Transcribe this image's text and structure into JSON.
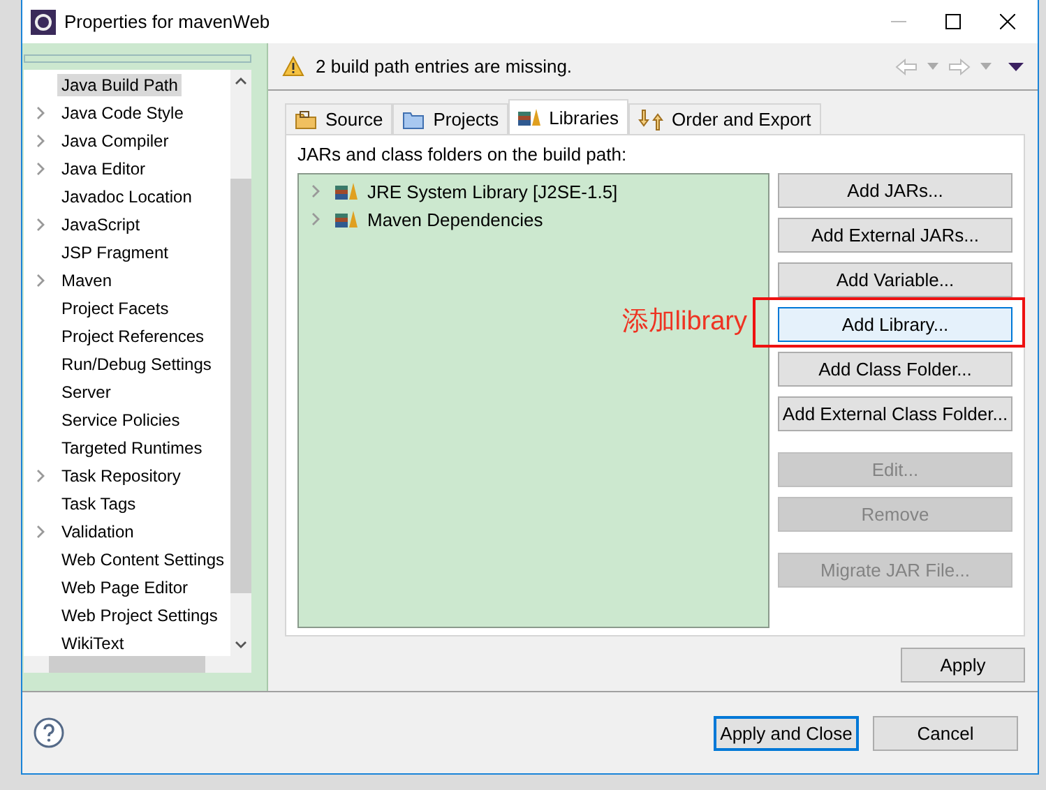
{
  "window": {
    "title": "Properties for mavenWeb"
  },
  "sidebar": {
    "items": [
      {
        "label": "Java Build Path",
        "kind": "leaf",
        "selected": true
      },
      {
        "label": "Java Code Style",
        "kind": "group",
        "selected": false
      },
      {
        "label": "Java Compiler",
        "kind": "group",
        "selected": false
      },
      {
        "label": "Java Editor",
        "kind": "group",
        "selected": false
      },
      {
        "label": "Javadoc Location",
        "kind": "leaf",
        "selected": false
      },
      {
        "label": "JavaScript",
        "kind": "group",
        "selected": false
      },
      {
        "label": "JSP Fragment",
        "kind": "leaf",
        "selected": false
      },
      {
        "label": "Maven",
        "kind": "group",
        "selected": false
      },
      {
        "label": "Project Facets",
        "kind": "leaf",
        "selected": false
      },
      {
        "label": "Project References",
        "kind": "leaf",
        "selected": false
      },
      {
        "label": "Run/Debug Settings",
        "kind": "leaf",
        "selected": false
      },
      {
        "label": "Server",
        "kind": "leaf",
        "selected": false
      },
      {
        "label": "Service Policies",
        "kind": "leaf",
        "selected": false
      },
      {
        "label": "Targeted Runtimes",
        "kind": "leaf",
        "selected": false
      },
      {
        "label": "Task Repository",
        "kind": "group",
        "selected": false
      },
      {
        "label": "Task Tags",
        "kind": "leaf",
        "selected": false
      },
      {
        "label": "Validation",
        "kind": "group",
        "selected": false
      },
      {
        "label": "Web Content Settings",
        "kind": "leaf",
        "selected": false
      },
      {
        "label": "Web Page Editor",
        "kind": "leaf",
        "selected": false
      },
      {
        "label": "Web Project Settings",
        "kind": "leaf",
        "selected": false
      },
      {
        "label": "WikiText",
        "kind": "leaf",
        "selected": false
      }
    ]
  },
  "message": {
    "kind": "warning",
    "text": "2 build path entries are missing."
  },
  "tabs": [
    {
      "label": "Source",
      "selected": false
    },
    {
      "label": "Projects",
      "selected": false
    },
    {
      "label": "Libraries",
      "selected": true
    },
    {
      "label": "Order and Export",
      "selected": false
    }
  ],
  "libraries": {
    "label": "JARs and class folders on the build path:",
    "entries": [
      {
        "label": "JRE System Library [J2SE-1.5]",
        "expanded": false
      },
      {
        "label": "Maven Dependencies",
        "expanded": false
      }
    ],
    "button_groups": [
      [
        {
          "label": "Add JARs...",
          "disabled": false,
          "highlighted": false
        },
        {
          "label": "Add External JARs...",
          "disabled": false,
          "highlighted": false
        },
        {
          "label": "Add Variable...",
          "disabled": false,
          "highlighted": false
        },
        {
          "label": "Add Library...",
          "disabled": false,
          "highlighted": true
        },
        {
          "label": "Add Class Folder...",
          "disabled": false,
          "highlighted": false
        },
        {
          "label": "Add External Class Folder...",
          "disabled": false,
          "highlighted": false
        }
      ],
      [
        {
          "label": "Edit...",
          "disabled": true,
          "highlighted": false
        },
        {
          "label": "Remove",
          "disabled": true,
          "highlighted": false
        }
      ],
      [
        {
          "label": "Migrate JAR File...",
          "disabled": true,
          "highlighted": false
        }
      ]
    ],
    "annotation": {
      "text": "添加library"
    },
    "apply": "Apply"
  },
  "footer": {
    "buttons": [
      {
        "label": "Apply and Close",
        "default": true
      },
      {
        "label": "Cancel",
        "default": false
      }
    ]
  }
}
